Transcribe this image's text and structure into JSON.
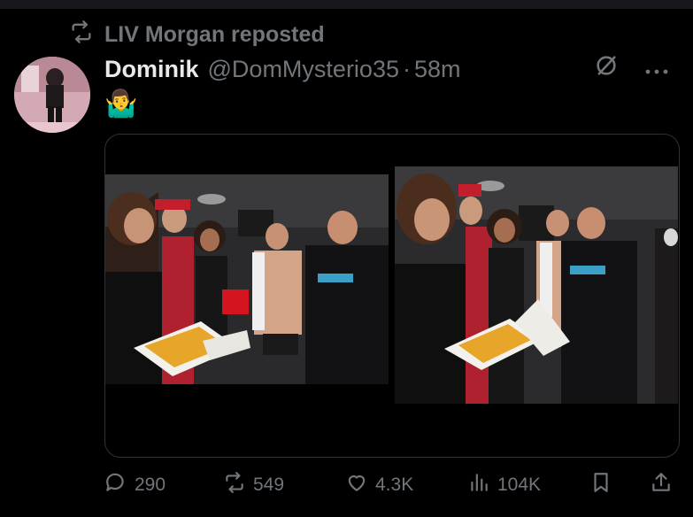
{
  "repost": {
    "label": "LIV Morgan reposted"
  },
  "post": {
    "display_name": "Dominik",
    "handle": "@DomMysterio35",
    "separator": "·",
    "time": "58m",
    "text": "🤷‍♂️"
  },
  "stats": {
    "replies": "290",
    "reposts": "549",
    "likes": "4.3K",
    "views": "104K"
  },
  "colors": {
    "muted": "#71767b",
    "text": "#e7e9ea",
    "border": "#2f3336",
    "bg": "#000000"
  }
}
